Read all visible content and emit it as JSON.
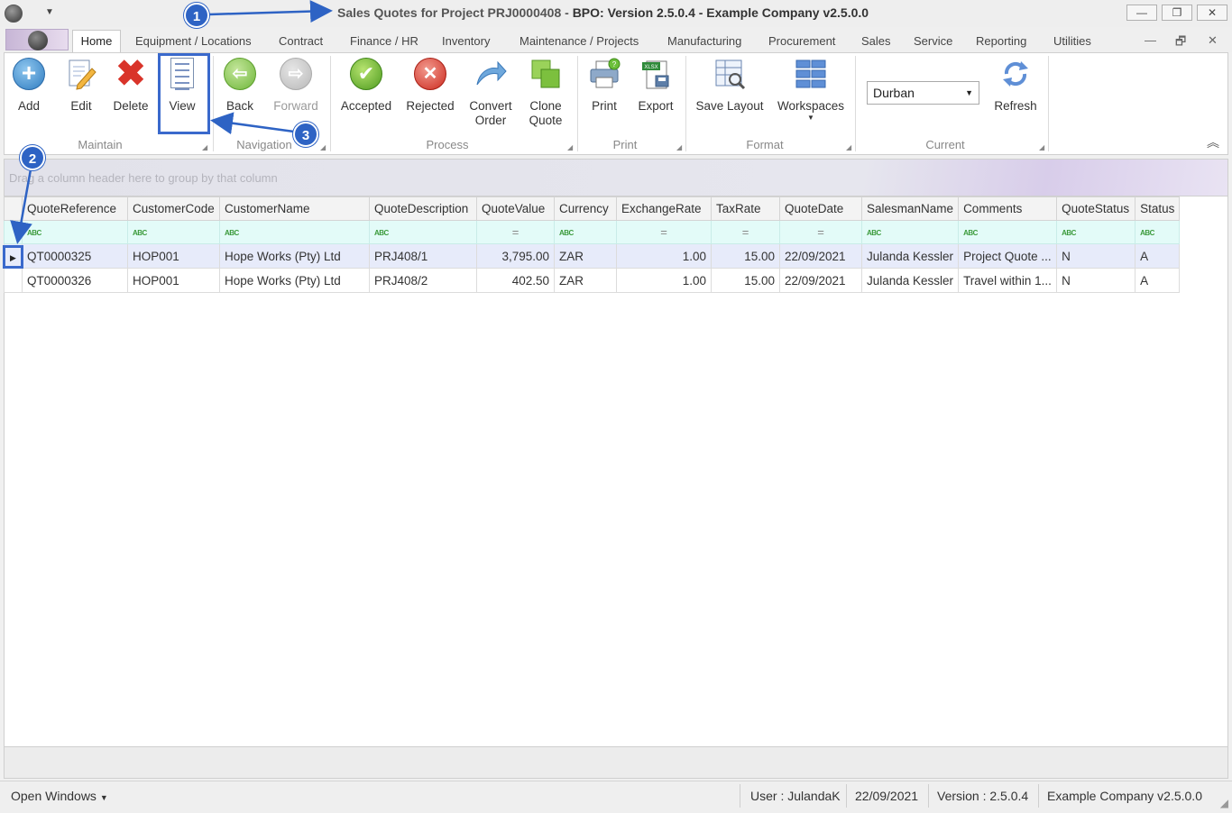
{
  "window": {
    "title_gray": "Sales Quotes for Project PRJ0000408 -",
    "title_bold": "BPO: Version 2.5.0.4 - Example Company v2.5.0.0",
    "controls": {
      "minimize": "—",
      "restore": "❐",
      "close": "✕"
    }
  },
  "menu": {
    "tabs": [
      "Home",
      "Equipment / Locations",
      "Contract",
      "Finance / HR",
      "Inventory",
      "Maintenance / Projects",
      "Manufacturing",
      "Procurement",
      "Sales",
      "Service",
      "Reporting",
      "Utilities"
    ],
    "active": "Home",
    "mdi_controls": {
      "minimize": "—",
      "restore": "🗗",
      "close": "✕"
    }
  },
  "ribbon": {
    "groups": {
      "maintain": "Maintain",
      "navigation": "Navigation",
      "process": "Process",
      "print": "Print",
      "format": "Format",
      "current": "Current"
    },
    "buttons": {
      "add": "Add",
      "edit": "Edit",
      "delete": "Delete",
      "view": "View",
      "back": "Back",
      "forward": "Forward",
      "accepted": "Accepted",
      "rejected": "Rejected",
      "convert_order_1": "Convert",
      "convert_order_2": "Order",
      "clone_quote_1": "Clone",
      "clone_quote_2": "Quote",
      "print": "Print",
      "export": "Export",
      "save_layout": "Save Layout",
      "workspaces": "Workspaces",
      "refresh": "Refresh"
    },
    "site_select": {
      "value": "Durban"
    }
  },
  "grid": {
    "group_hint": "Drag a column header here to group by that column",
    "columns": [
      "QuoteReference",
      "CustomerCode",
      "CustomerName",
      "QuoteDescription",
      "QuoteValue",
      "Currency",
      "ExchangeRate",
      "TaxRate",
      "QuoteDate",
      "SalesmanName",
      "Comments",
      "QuoteStatus",
      "Status"
    ],
    "rows": [
      [
        "QT0000325",
        "HOP001",
        "Hope Works (Pty) Ltd",
        "PRJ408/1",
        "3,795.00",
        "ZAR",
        "1.00",
        "15.00",
        "22/09/2021",
        "Julanda Kessler",
        "Project Quote ...",
        "N",
        "A"
      ],
      [
        "QT0000326",
        "HOP001",
        "Hope Works (Pty) Ltd",
        "PRJ408/2",
        "402.50",
        "ZAR",
        "1.00",
        "15.00",
        "22/09/2021",
        "Julanda Kessler",
        "Travel within 1...",
        "N",
        "A"
      ]
    ],
    "selected_row": 0
  },
  "statusbar": {
    "open_windows": "Open Windows",
    "user": "User : JulandaK",
    "date": "22/09/2021",
    "version": "Version : 2.5.0.4",
    "company": "Example Company v2.5.0.0"
  },
  "annotations": {
    "badge1": "1",
    "badge2": "2",
    "badge3": "3"
  },
  "colors": {
    "accent": "#2e63c4",
    "filter_row": "#e3fbf8",
    "selected_row": "#e7ebfa"
  }
}
